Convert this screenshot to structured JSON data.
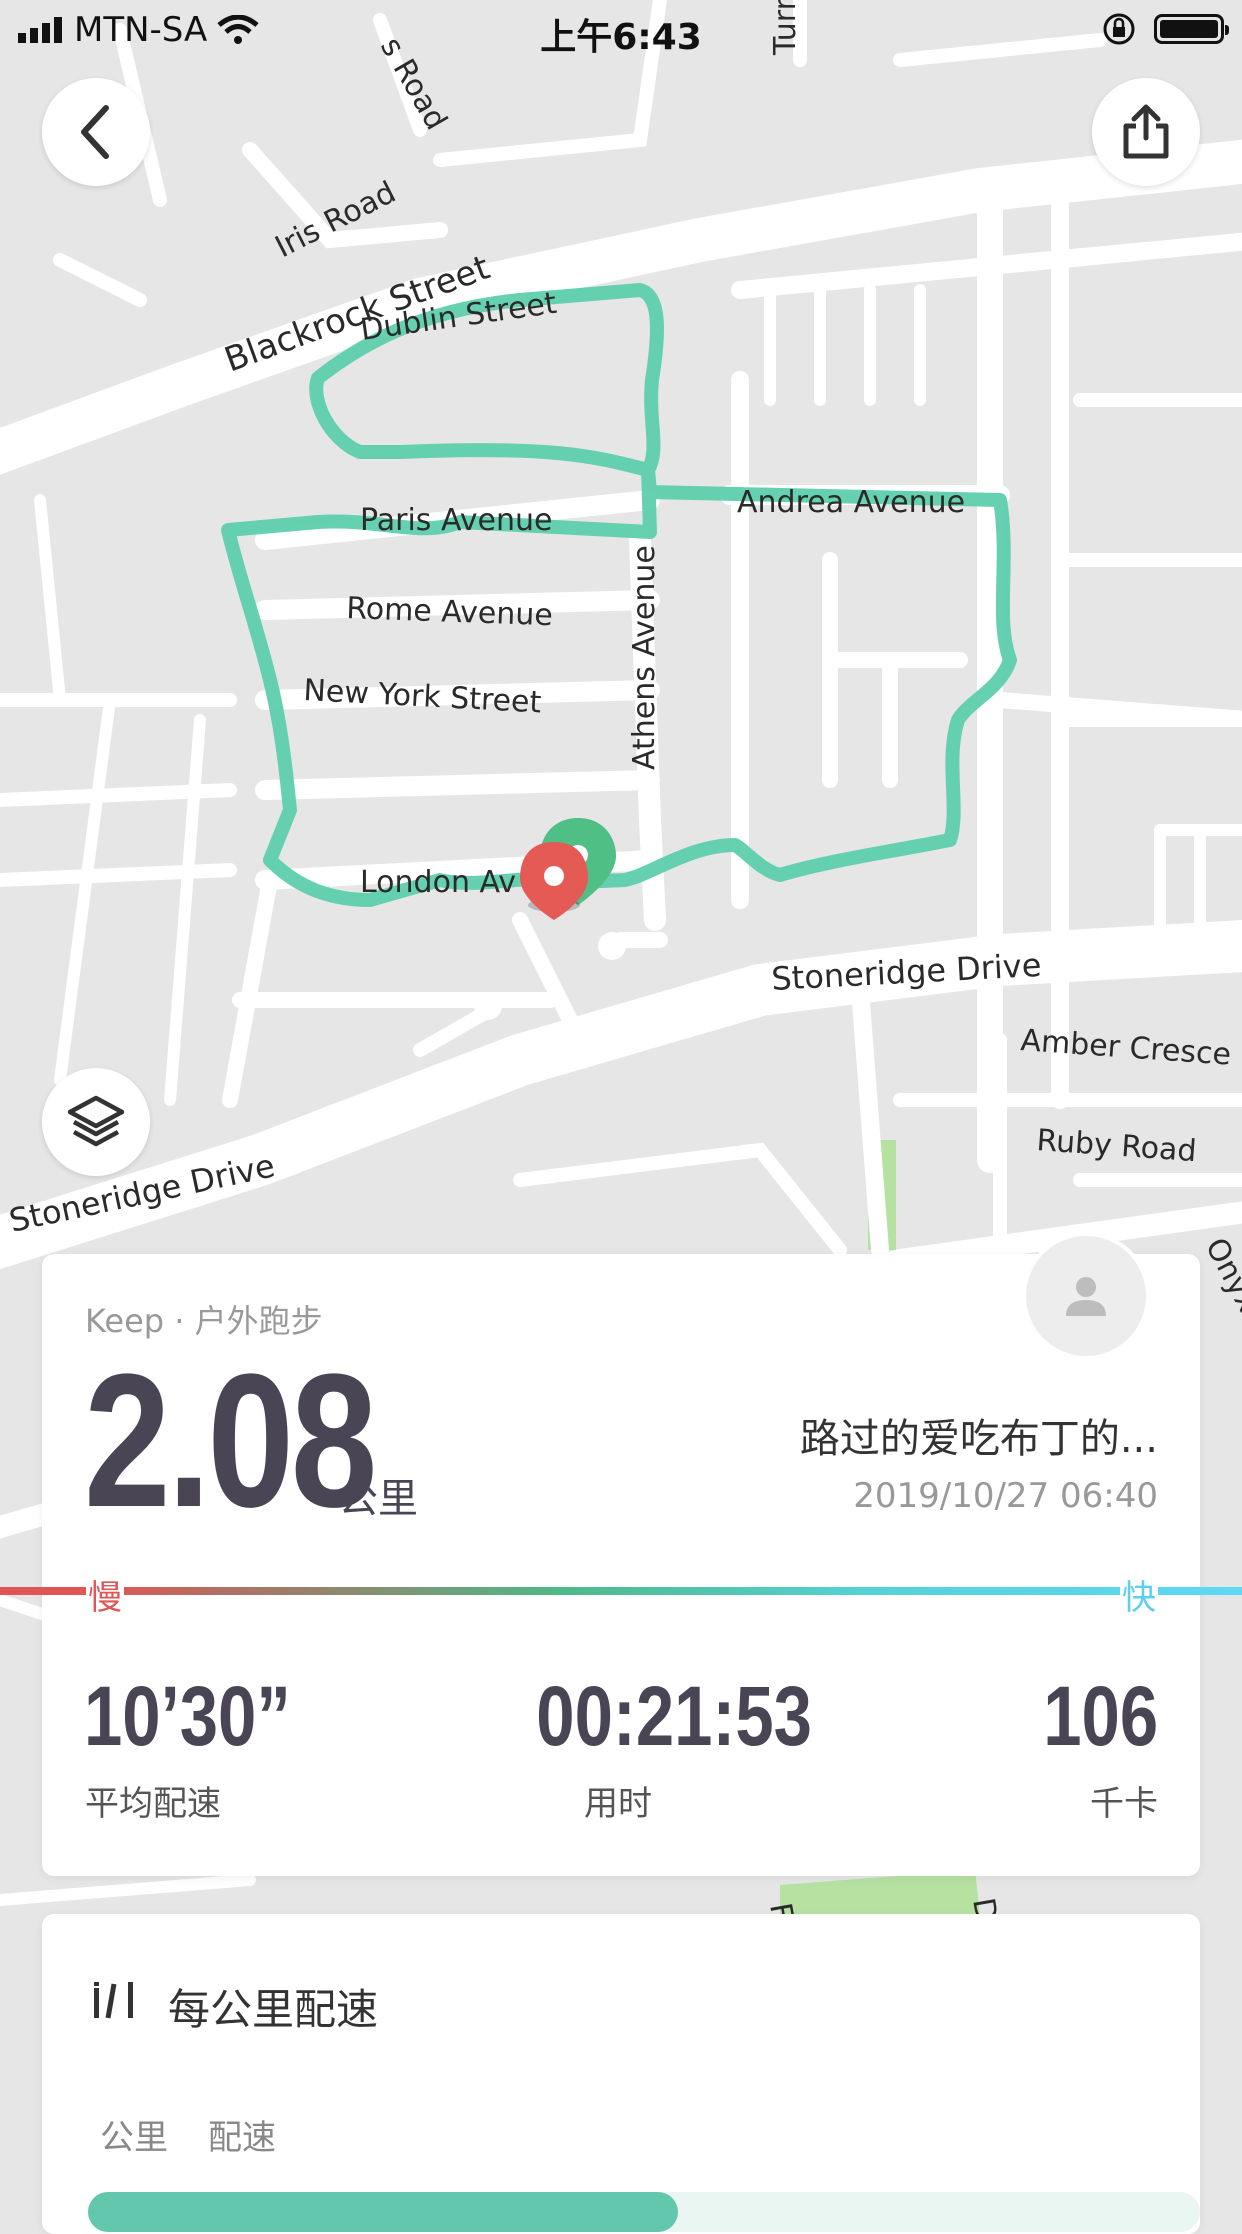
{
  "status_bar": {
    "carrier": "MTN-SA",
    "time": "上午6:43"
  },
  "map": {
    "street_labels": [
      "s Road",
      "Turn",
      "Iris Road",
      "Blackrock Street",
      "Dublin Street",
      "Andrea Avenue",
      "Paris Avenue",
      "Rome Avenue",
      "New York Street",
      "Athens Avenue",
      "London Av",
      "Stoneridge Drive",
      "Amber Cresce",
      "Ruby Road",
      "Stoneridge Drive",
      "Onyx",
      "F",
      "D"
    ],
    "route_color": "#5ecfad"
  },
  "summary": {
    "source": "Keep · 户外跑步",
    "distance": "2.08",
    "distance_unit": "公里",
    "user_name": "路过的爱吃布丁的...",
    "datetime": "2019/10/27 06:40",
    "pace_slow_label": "慢",
    "pace_fast_label": "快",
    "stats": [
      {
        "value": "10’30”",
        "label": "平均配速"
      },
      {
        "value": "00:21:53",
        "label": "用时"
      },
      {
        "value": "106",
        "label": "千卡"
      }
    ]
  },
  "pace_card": {
    "title": "每公里配速",
    "col_km": "公里",
    "col_pace": "配速"
  },
  "colors": {
    "slow": "#e05656",
    "fast": "#5ed0ec",
    "route": "#5ecfad",
    "text_dark": "#4a4555"
  },
  "icons": [
    "back-arrow-icon",
    "share-icon",
    "layers-icon",
    "user-avatar-icon",
    "pace-chart-icon",
    "signal-icon",
    "wifi-icon",
    "lock-rotation-icon",
    "battery-icon",
    "start-marker-icon",
    "end-marker-icon"
  ]
}
